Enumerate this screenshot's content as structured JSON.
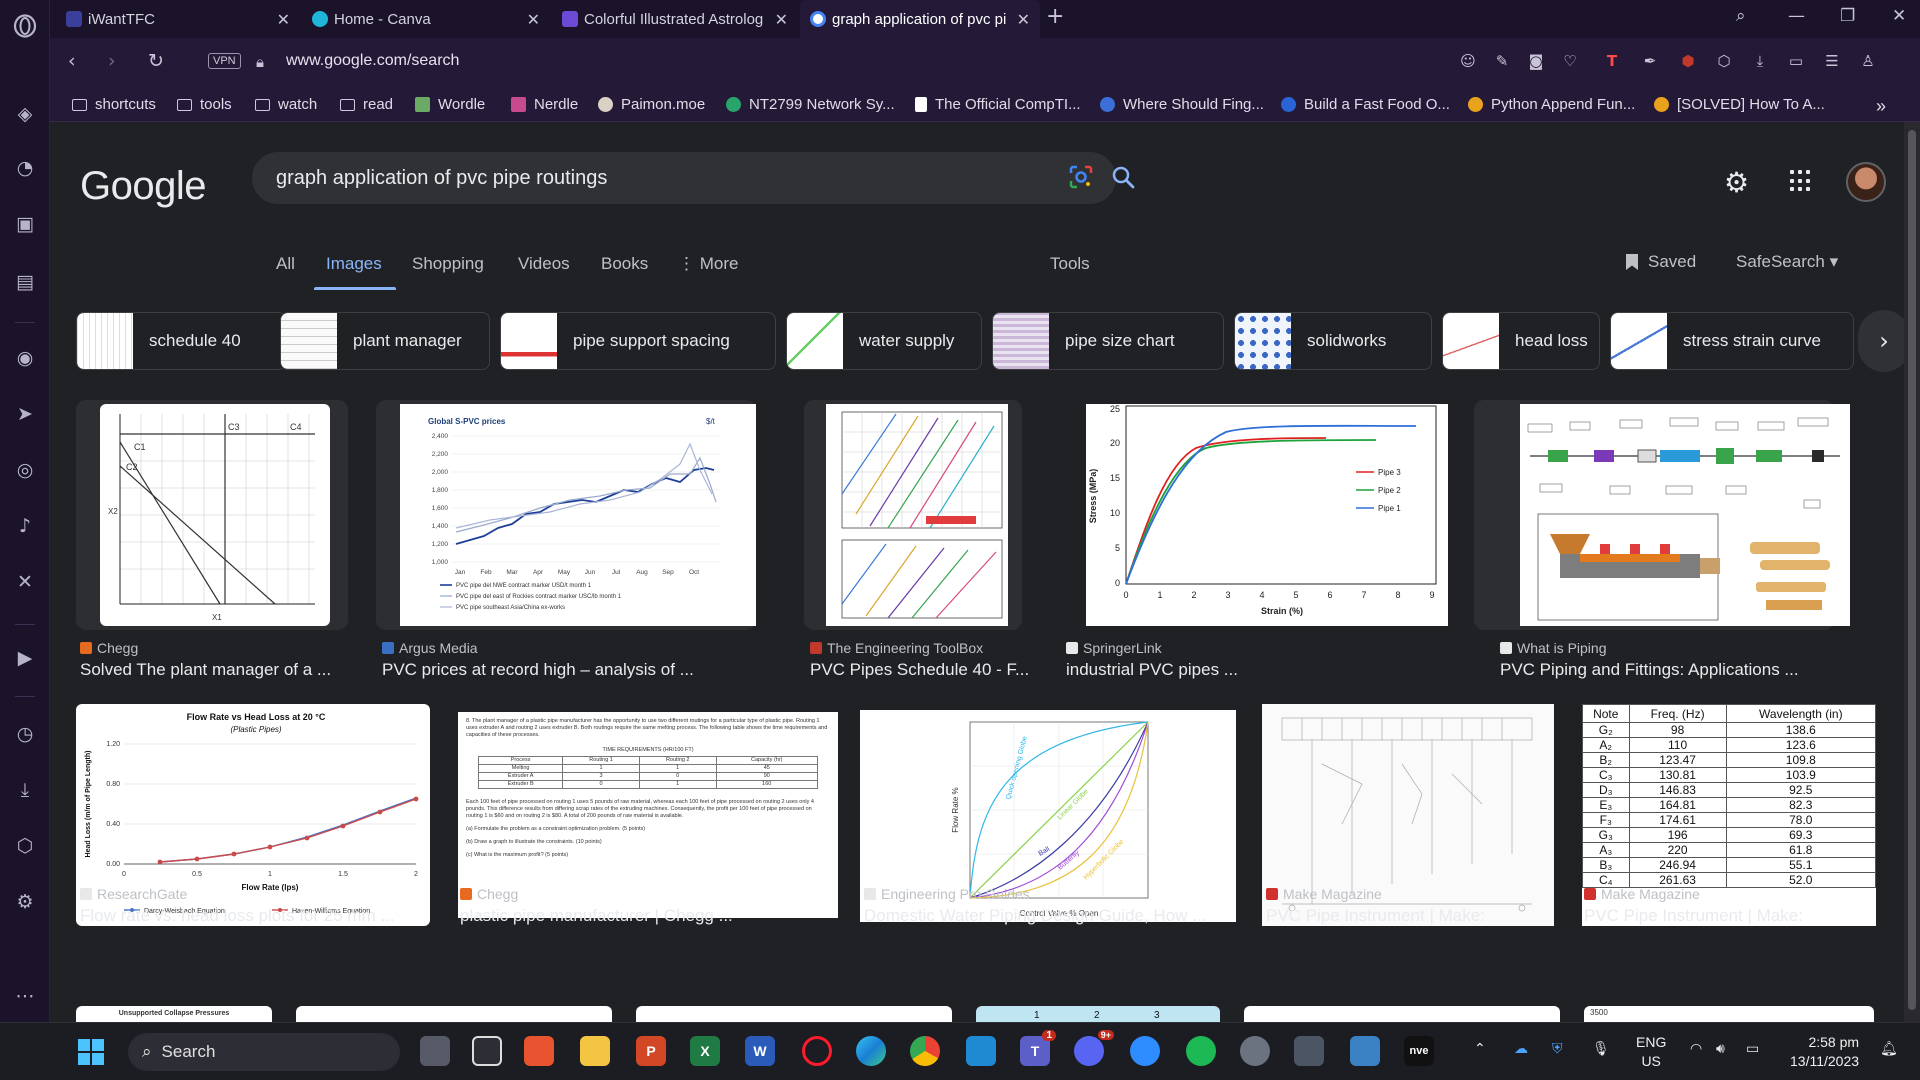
{
  "browser": {
    "tabs": [
      {
        "title": "iWantTFC",
        "color": "#3a3f9c"
      },
      {
        "title": "Home - Canva",
        "color": "#1fb6d9"
      },
      {
        "title": "Colorful Illustrated Astrolog",
        "color": "#6d4ad6"
      },
      {
        "title": "graph application of pvc pi",
        "color": "#ffffff"
      }
    ],
    "url": "www.google.com/search",
    "vpn_label": "VPN",
    "bookmarks": [
      {
        "label": "shortcuts",
        "kind": "folder"
      },
      {
        "label": "tools",
        "kind": "folder"
      },
      {
        "label": "watch",
        "kind": "folder"
      },
      {
        "label": "read",
        "kind": "folder"
      },
      {
        "label": "Wordle",
        "kind": "site",
        "color": "#6aaa64"
      },
      {
        "label": "Nerdle",
        "kind": "site",
        "color": "#c74a8c"
      },
      {
        "label": "Paimon.moe",
        "kind": "site",
        "color": "#d9d2c4"
      },
      {
        "label": "NT2799 Network Sy...",
        "kind": "site",
        "color": "#27a56b"
      },
      {
        "label": "The Official CompTI...",
        "kind": "site",
        "color": "#ffffff"
      },
      {
        "label": "Where Should Fing...",
        "kind": "site",
        "color": "#3d6fd8"
      },
      {
        "label": "Build a Fast Food O...",
        "kind": "site",
        "color": "#2a63d6"
      },
      {
        "label": "Python Append Fun...",
        "kind": "site",
        "color": "#e9a21b"
      },
      {
        "label": "[SOLVED] How To A...",
        "kind": "site",
        "color": "#e9a21b"
      }
    ]
  },
  "google": {
    "logo": "Google",
    "query": "graph application of pvc pipe routings",
    "tabs": [
      "All",
      "Images",
      "Shopping",
      "Videos",
      "Books",
      "More"
    ],
    "active_tab": "Images",
    "tools": "Tools",
    "saved": "Saved",
    "safesearch": "SafeSearch",
    "chips": [
      "schedule 40",
      "plant manager",
      "pipe support spacing",
      "water supply",
      "pipe size chart",
      "solidworks",
      "head loss",
      "stress strain curve"
    ],
    "row1": [
      {
        "source": "Chegg",
        "title": "Solved The plant manager of a ...",
        "fav": "#e66a1f"
      },
      {
        "source": "Argus Media",
        "title": "PVC prices at record high – analysis of ...",
        "fav": "#3b6fc4"
      },
      {
        "source": "The Engineering ToolBox",
        "title": "PVC Pipes Schedule 40 - F...",
        "fav": "#c0392b"
      },
      {
        "source": "SpringerLink",
        "title": "industrial PVC pipes ...",
        "fav": "#e8e8e8"
      },
      {
        "source": "What is Piping",
        "title": "PVC Piping and Fittings: Applications ...",
        "fav": "#e8e8e8"
      }
    ],
    "row2": [
      {
        "source": "ResearchGate",
        "title": "Flow rate vs. head loss plots for 25 mm ...",
        "fav": "#e8e8e8"
      },
      {
        "source": "Chegg",
        "title": "plastic pipe manufacturer | Chegg ...",
        "fav": "#e66a1f"
      },
      {
        "source": "Engineering Pro Guides",
        "title": "Domestic Water Piping Design Guide, How ...",
        "fav": "#e8e8e8"
      },
      {
        "source": "Make Magazine",
        "title": "PVC Pipe Instrument | Make:",
        "fav": "#d0312d"
      },
      {
        "source": "Make Magazine",
        "title": "PVC Pipe Instrument | Make:",
        "fav": "#d0312d"
      }
    ]
  },
  "thumbs": {
    "chegg_plot": {
      "title_c": [
        "C3",
        "C4",
        "C1",
        "C2"
      ],
      "xlabel": "X1",
      "ylabel": "X2"
    },
    "argus": {
      "title": "Global S-PVC prices",
      "unit": "$/t",
      "yticks": [
        "2,400",
        "2,200",
        "2,000",
        "1,800",
        "1,600",
        "1,400",
        "1,200",
        "1,000"
      ],
      "xticks": [
        "Jan",
        "Feb",
        "Mar",
        "Apr",
        "May",
        "Jun",
        "Jul",
        "Aug",
        "Sep",
        "Oct"
      ],
      "legend": [
        "PVC pipe del NWE contract marker USD/t month 1",
        "PVC pipe del east of Rockies contract marker USC/lb month 1",
        "PVC pipe southeast Asia/China ex-works"
      ]
    },
    "springer": {
      "ylabel": "Stress (MPa)",
      "xlabel": "Strain (%)",
      "legend": [
        "Pipe 3",
        "Pipe 2",
        "Pipe 1"
      ],
      "yticks": [
        "25",
        "20",
        "15",
        "10",
        "5",
        "0"
      ],
      "xticks": [
        "0",
        "1",
        "2",
        "3",
        "4",
        "5",
        "6",
        "7",
        "8",
        "9"
      ]
    },
    "research": {
      "title": "Flow Rate vs Head Loss at 20 °C",
      "subtitle": "(Plastic Pipes)",
      "ylabel": "Head Loss (m/m of Pipe Length)",
      "xlabel": "Flow Rate (lps)",
      "legend": [
        "Darcy-Weisbach Equation",
        "Hazen-Williams Equation"
      ],
      "yticks": [
        "1.20",
        "0.80",
        "0.40",
        "0.00"
      ],
      "xticks": [
        "0",
        "0.5",
        "1",
        "1.5",
        "2"
      ]
    },
    "chegg_text": {
      "para1": "8. The plant manager of a plastic pipe manufacturer has the opportunity to use two different routings for a particular type of plastic pipe. Routing 1 uses extruder A and routing 2 uses extruder B. Both routings require the same melting process. The following table shows the time requirements and capacities of these processes.",
      "table_title": "TIME REQUIREMENTS (HR/100 FT)",
      "headers": [
        "Process",
        "Routing 1",
        "Routing 2",
        "Capacity (hr)"
      ],
      "rows": [
        [
          "Melting",
          "1",
          "1",
          "45"
        ],
        [
          "Extruder A",
          "3",
          "0",
          "90"
        ],
        [
          "Extruder B",
          "0",
          "1",
          "160"
        ]
      ],
      "para2": "Each 100 feet of pipe processed on routing 1 uses 5 pounds of raw material, whereas each 100 feet of pipe processed on routing 2 uses only 4 pounds. This difference results from differing scrap rates of the extruding machines. Consequently, the profit per 100 feet of pipe processed on routing 1 is $60 and on routing 2 is $80. A total of 200 pounds of raw material is available.",
      "qa": "(a) Formulate the problem as a constraint optimization problem. (5 points)",
      "qb": "(b) Draw a graph to illustrate the constraints. (10 points)",
      "qc": "(c) What is the maximum profit? (5 points)"
    },
    "valve": {
      "ylabel": "Flow Rate %",
      "xlabel": "Control Valve % Open",
      "labels": [
        "Quick opening Globe",
        "Linear Globe",
        "Ball",
        "Butterfly",
        "Hyperbolic Globe"
      ]
    },
    "notes": {
      "headers": [
        "Note",
        "Freq. (Hz)",
        "Wavelength (in)"
      ],
      "rows": [
        [
          "G₂",
          "98",
          "138.6"
        ],
        [
          "A₂",
          "110",
          "123.6"
        ],
        [
          "B₂",
          "123.47",
          "109.8"
        ],
        [
          "C₃",
          "130.81",
          "103.9"
        ],
        [
          "D₃",
          "146.83",
          "92.5"
        ],
        [
          "E₃",
          "164.81",
          "82.3"
        ],
        [
          "F₃",
          "174.61",
          "78.0"
        ],
        [
          "G₃",
          "196",
          "69.3"
        ],
        [
          "A₃",
          "220",
          "61.8"
        ],
        [
          "B₃",
          "246.94",
          "55.1"
        ],
        [
          "C₄",
          "261.63",
          "52.0"
        ]
      ]
    },
    "row3": {
      "collapse": "Unsupported Collapse Pressures",
      "nums": [
        "1",
        "2",
        "3"
      ],
      "ytop": "3500"
    }
  },
  "taskbar": {
    "search": "Search",
    "lang": [
      "ENG",
      "US"
    ],
    "time": "2:58 pm",
    "date": "13/11/2023",
    "discord_badge": "9+",
    "teams_badge": "1"
  }
}
